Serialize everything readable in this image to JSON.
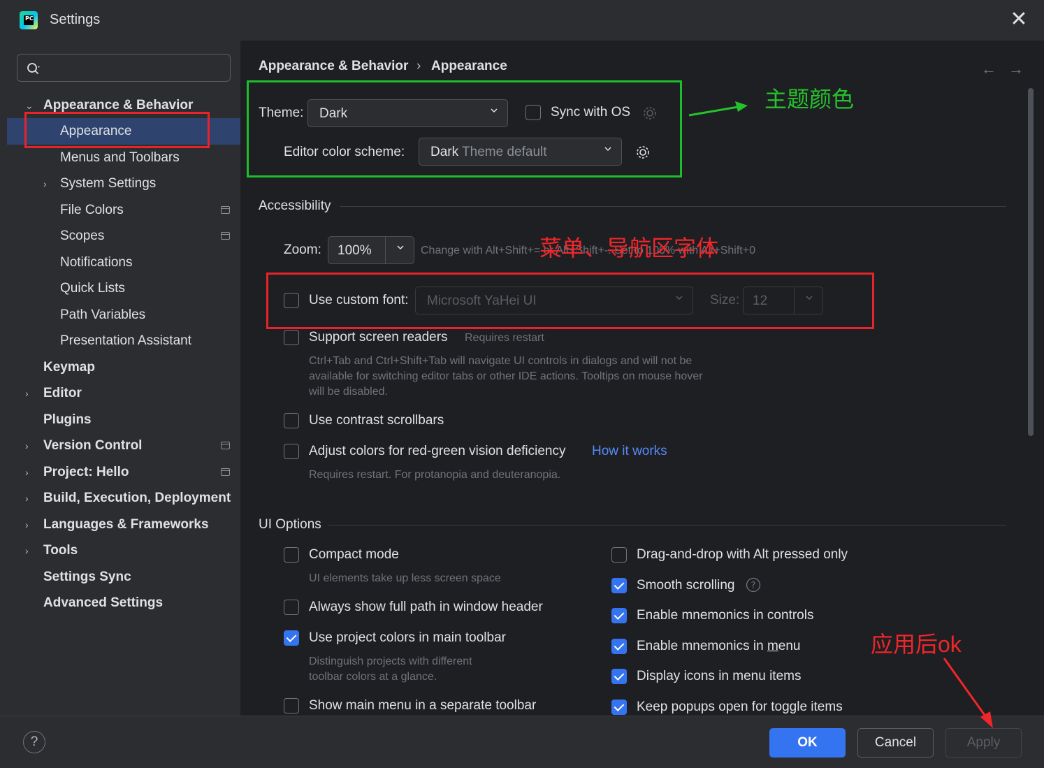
{
  "window": {
    "title": "Settings"
  },
  "search": {
    "placeholder": ""
  },
  "sidebar": {
    "items": [
      {
        "label": "Appearance & Behavior"
      },
      {
        "label": "Appearance"
      },
      {
        "label": "Menus and Toolbars"
      },
      {
        "label": "System Settings"
      },
      {
        "label": "File Colors"
      },
      {
        "label": "Scopes"
      },
      {
        "label": "Notifications"
      },
      {
        "label": "Quick Lists"
      },
      {
        "label": "Path Variables"
      },
      {
        "label": "Presentation Assistant"
      },
      {
        "label": "Keymap"
      },
      {
        "label": "Editor"
      },
      {
        "label": "Plugins"
      },
      {
        "label": "Version Control"
      },
      {
        "label": "Project: Hello"
      },
      {
        "label": "Build, Execution, Deployment"
      },
      {
        "label": "Languages & Frameworks"
      },
      {
        "label": "Tools"
      },
      {
        "label": "Settings Sync"
      },
      {
        "label": "Advanced Settings"
      }
    ]
  },
  "breadcrumb": {
    "parent": "Appearance & Behavior",
    "separator": "›",
    "current": "Appearance"
  },
  "theme": {
    "label": "Theme:",
    "value": "Dark",
    "sync_label": "Sync with OS",
    "editor_scheme_label": "Editor color scheme:",
    "editor_scheme_value_dark": "Dark",
    "editor_scheme_value_rest": " Theme default"
  },
  "accessibility": {
    "section": "Accessibility",
    "zoom_label": "Zoom:",
    "zoom_value": "100%",
    "zoom_hint_a": "Change with Alt+Shift+",
    "zoom_hint_b": " or Alt+Shift+",
    "zoom_hint_c": ". Set to 100% with Alt+Shift+0",
    "custom_font_label": "Use custom font:",
    "custom_font_value": "Microsoft YaHei UI",
    "size_label": "Size:",
    "size_value": "12",
    "screen_readers_label": "Support screen readers",
    "screen_readers_hint": "Requires restart",
    "screen_readers_desc_1": "Ctrl+Tab and Ctrl+Shift+Tab will navigate UI controls in dialogs and will not be",
    "screen_readers_desc_2": "available for switching editor tabs or other IDE actions. Tooltips on mouse hover",
    "screen_readers_desc_3": "will be disabled.",
    "contrast_label": "Use contrast scrollbars",
    "color_def_label": "Adjust colors for red-green vision deficiency",
    "how_it_works": "How it works",
    "color_def_hint": "Requires restart. For protanopia and deuteranopia."
  },
  "ui_options": {
    "section": "UI Options",
    "compact_label": "Compact mode",
    "compact_hint": "UI elements take up less screen space",
    "full_path_label": "Always show full path in window header",
    "project_colors_label": "Use project colors in main toolbar",
    "project_colors_hint_1": "Distinguish projects with different",
    "project_colors_hint_2": "toolbar colors at a glance.",
    "main_menu_label": "Show main menu in a separate toolbar",
    "dnd_label": "Drag-and-drop with Alt pressed only",
    "smooth_label": "Smooth scrolling",
    "mnemonics_controls_label": "Enable mnemonics in controls",
    "mnemonics_menu_label_a": "Enable mnemonics in ",
    "mnemonics_menu_label_b": "m",
    "mnemonics_menu_label_c": "enu",
    "icons_menu_label": "Display icons in menu items",
    "popups_label": "Keep popups open for toggle items"
  },
  "checkboxes": {
    "sync_with_os": false,
    "custom_font": false,
    "screen_readers": false,
    "contrast": false,
    "color_def": false,
    "compact": false,
    "full_path": false,
    "project_colors": true,
    "main_menu": false,
    "dnd": false,
    "smooth": true,
    "mnemonics_controls": true,
    "mnemonics_menu": true,
    "icons_menu": true,
    "popups": true
  },
  "footer": {
    "help": "?",
    "ok": "OK",
    "cancel": "Cancel",
    "apply": "Apply"
  },
  "annotations": {
    "theme_color": "主题颜色",
    "menu_font": "菜单、导航区字体",
    "apply_ok": "应用后ok"
  },
  "colors": {
    "accent": "#3574f0",
    "annotation_red": "#e8242a",
    "annotation_green": "#1dbd2c"
  }
}
